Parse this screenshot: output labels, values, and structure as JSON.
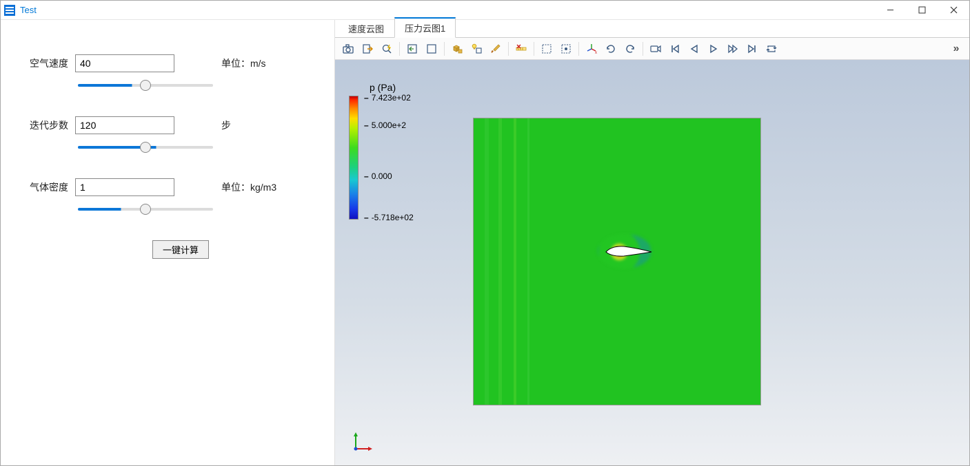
{
  "window": {
    "title": "Test"
  },
  "params": {
    "air_velocity": {
      "label": "空气速度",
      "value": "40",
      "unit": "单位：m/s",
      "slider_pct": 40
    },
    "iterations": {
      "label": "迭代步数",
      "value": "120",
      "unit": "步",
      "slider_pct": 58
    },
    "density": {
      "label": "气体密度",
      "value": "1",
      "unit": "单位：kg/m3",
      "slider_pct": 32
    }
  },
  "actions": {
    "calc": "一键计算"
  },
  "tabs": [
    {
      "label": "速度云图",
      "active": false
    },
    {
      "label": "压力云图1",
      "active": true
    }
  ],
  "toolbar": [
    "camera-icon",
    "export-icon",
    "search-zap-icon",
    "sep",
    "box-back-icon",
    "box-blank-icon",
    "sep",
    "cubes-icon",
    "lightbulb-cube-icon",
    "brush-icon",
    "sep",
    "ruler-cross-icon",
    "sep",
    "select-rect-icon",
    "select-all-icon",
    "sep",
    "axis-xyz-icon",
    "rotate-ccw-icon",
    "rotate-cw-icon",
    "sep",
    "camera-record-icon",
    "skip-first-icon",
    "play-rev-icon",
    "play-icon",
    "play-ff-icon",
    "skip-last-icon",
    "loop-icon"
  ],
  "chart_data": {
    "type": "heatmap",
    "title": "p (Pa)",
    "colorbar": {
      "min": -571.8,
      "max": 742.3,
      "ticks": [
        "7.423e+02",
        "5.000e+2",
        "0.000",
        "-5.718e+02"
      ]
    },
    "note": "2D pressure field around an airfoil; domain mostly ~0 Pa (green), high pressure (red/orange) at leading edge, low pressure (blue) around body."
  }
}
